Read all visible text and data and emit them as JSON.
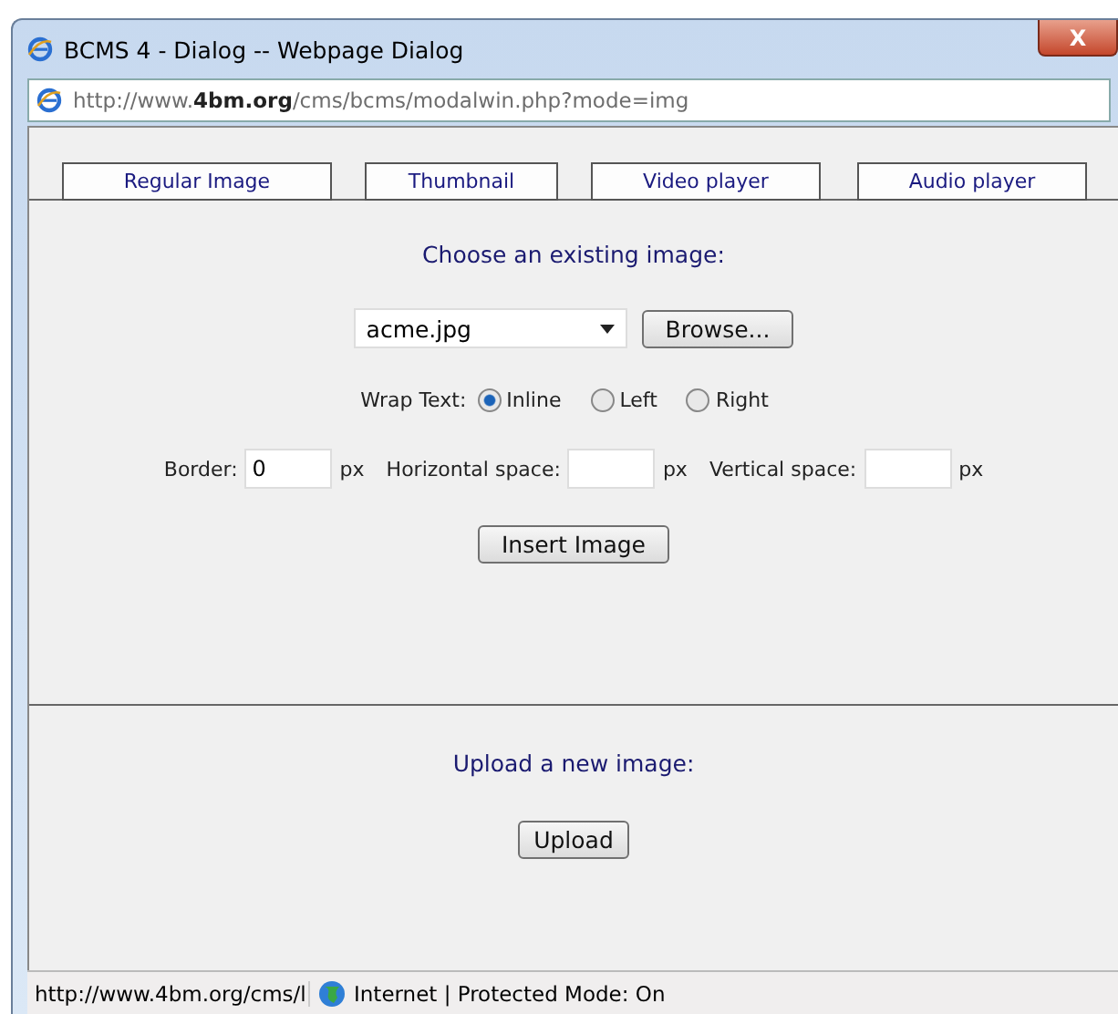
{
  "window": {
    "title": "BCMS 4 - Dialog -- Webpage Dialog",
    "close": "X"
  },
  "address": "http://www.**4bm.org**/cms/bcms/modalwin.php?mode=img",
  "tabs": [
    {
      "label": "Regular Image",
      "selected": false
    },
    {
      "label": "Thumbnail",
      "selected": false
    },
    {
      "label": "Video player",
      "selected": false
    },
    {
      "label": "Audio player",
      "selected": false
    }
  ],
  "existing": {
    "heading": "Choose an existing image:",
    "file": "acme.jpg",
    "browse": "Browse...",
    "wrap_label": "Wrap Text:",
    "wrap_options": [
      {
        "label": "Inline",
        "selected": true
      },
      {
        "label": "Left",
        "selected": false
      },
      {
        "label": "Right",
        "selected": false
      }
    ],
    "fields": [
      {
        "label": "Border:",
        "value": "0",
        "unit": "px"
      },
      {
        "label": "Horizontal space:",
        "unit": "px"
      },
      {
        "label": "Vertical space:",
        "unit": "px"
      }
    ],
    "insert": "Insert Image"
  },
  "upload": {
    "heading": "Upload a new image:",
    "button": "Upload"
  },
  "status_bar": {
    "url": "http://www.4bm.org/cms/l",
    "zone": "Internet | Protected Mode: On"
  }
}
